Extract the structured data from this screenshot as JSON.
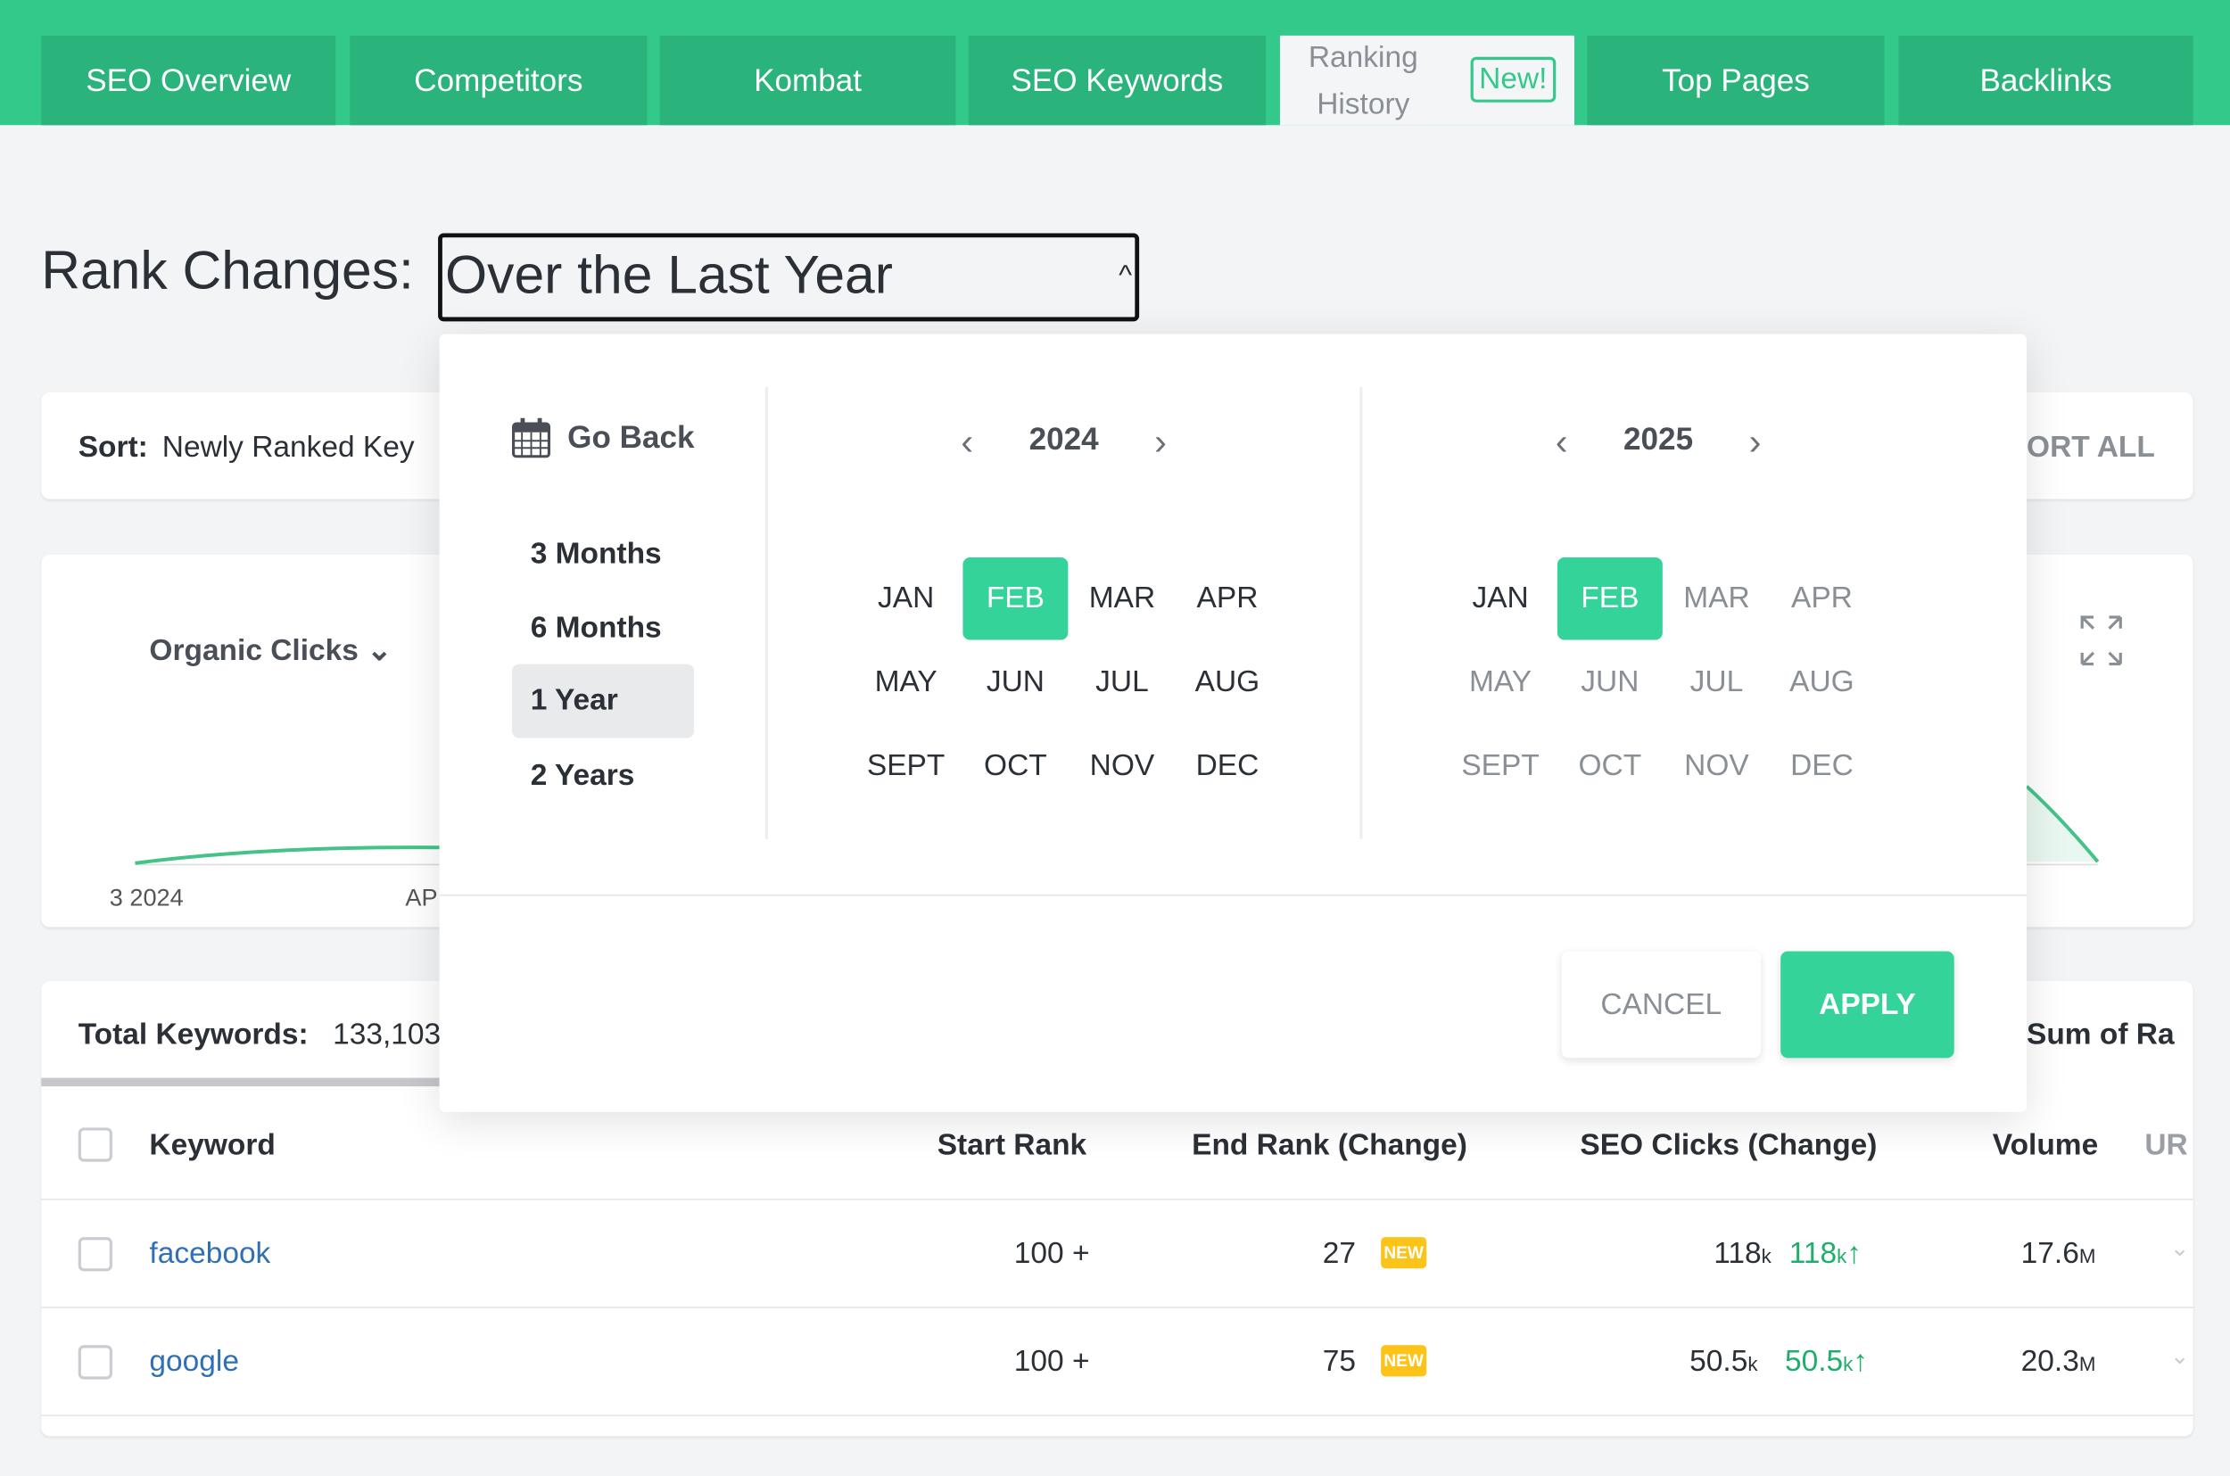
{
  "tabs": [
    {
      "label": "SEO Overview"
    },
    {
      "label": "Competitors"
    },
    {
      "label": "Kombat"
    },
    {
      "label": "SEO Keywords"
    },
    {
      "label_line1": "Ranking",
      "label_line2": "History",
      "badge": "New!",
      "active": true
    },
    {
      "label": "Top Pages"
    },
    {
      "label": "Backlinks"
    }
  ],
  "header": {
    "title": "Rank Changes:",
    "range_value": "Over the Last Year"
  },
  "sort": {
    "label": "Sort:",
    "value": "Newly Ranked Key",
    "sort_all": "ORT ALL"
  },
  "chart": {
    "metric": "Organic Clicks",
    "x_ticks": [
      "3 2024",
      "API"
    ]
  },
  "datepicker": {
    "go_back": "Go Back",
    "presets": [
      "3 Months",
      "6 Months",
      "1 Year",
      "2 Years"
    ],
    "selected_preset": "1 Year",
    "calendars": [
      {
        "year": "2024",
        "months": [
          "JAN",
          "FEB",
          "MAR",
          "APR",
          "MAY",
          "JUN",
          "JUL",
          "AUG",
          "SEPT",
          "OCT",
          "NOV",
          "DEC"
        ],
        "selected": "FEB"
      },
      {
        "year": "2025",
        "months": [
          "JAN",
          "FEB",
          "MAR",
          "APR",
          "MAY",
          "JUN",
          "JUL",
          "AUG",
          "SEPT",
          "OCT",
          "NOV",
          "DEC"
        ],
        "selected": "FEB"
      }
    ],
    "cancel": "CANCEL",
    "apply": "APPLY"
  },
  "table": {
    "total_label": "Total Keywords:",
    "total_value": "133,103",
    "sum_label": "Sum of Ra",
    "columns": [
      "Keyword",
      "Start Rank",
      "End Rank (Change)",
      "SEO Clicks (Change)",
      "Volume",
      "UR"
    ],
    "rows": [
      {
        "keyword": "facebook",
        "start_rank": "100 +",
        "end_rank": "27",
        "badge": "NEW",
        "clicks": "118",
        "clicks_unit": "k",
        "change": "118",
        "change_unit": "k",
        "volume": "17.6",
        "volume_unit": "M"
      },
      {
        "keyword": "google",
        "start_rank": "100 +",
        "end_rank": "75",
        "badge": "NEW",
        "clicks": "50.5",
        "clicks_unit": "k",
        "change": "50.5",
        "change_unit": "k",
        "volume": "20.3",
        "volume_unit": "M"
      }
    ]
  },
  "colors": {
    "brand": "#33c98a",
    "tab": "#2bb37c",
    "selected": "#34d399",
    "new_badge": "#fcc419",
    "positive": "#1fae6b"
  }
}
